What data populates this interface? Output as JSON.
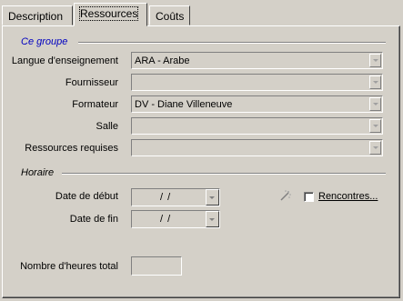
{
  "tabs": [
    {
      "label": "Description"
    },
    {
      "label": "Ressources"
    },
    {
      "label": "Coûts"
    }
  ],
  "group_ce_groupe": {
    "title": "Ce groupe",
    "title_color": "#0000c0",
    "fields": {
      "langue": {
        "label": "Langue d'enseignement",
        "value": "ARA - Arabe"
      },
      "fournisseur": {
        "label": "Fournisseur",
        "value": ""
      },
      "formateur": {
        "label": "Formateur",
        "value": "DV - Diane Villeneuve"
      },
      "salle": {
        "label": "Salle",
        "value": ""
      },
      "ressources": {
        "label": "Ressources requises",
        "value": ""
      }
    }
  },
  "group_horaire": {
    "title": "Horaire",
    "date_debut": {
      "label": "Date de début",
      "value": "/   /"
    },
    "date_fin": {
      "label": "Date de fin",
      "value": "/   /"
    },
    "rencontres": {
      "label": "Rencontres...",
      "checked": false,
      "icon": "wand-icon"
    },
    "heures": {
      "label": "Nombre d'heures total",
      "value": ""
    }
  }
}
